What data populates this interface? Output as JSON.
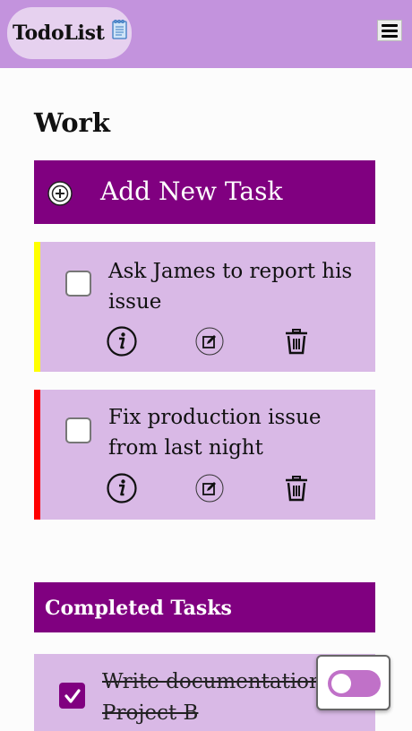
{
  "header": {
    "brand": "TodoList",
    "brand_icon": "notepad-icon",
    "menu_icon": "hamburger-menu-icon",
    "background": "#c393dd"
  },
  "main": {
    "section_title": "Work",
    "add_task_label": "Add New Task",
    "tasks": [
      {
        "text": "Ask James to report his issue",
        "checked": false,
        "priority_color": "#ffff00"
      },
      {
        "text": "Fix production issue from last night",
        "checked": false,
        "priority_color": "#ff0000"
      }
    ],
    "task_actions": [
      "info-icon",
      "edit-icon",
      "trash-icon"
    ],
    "completed_title": "Completed Tasks",
    "completed_tasks": [
      {
        "text": "Write documentation Project B",
        "checked": true
      }
    ],
    "theme_toggle": {
      "on": false
    }
  },
  "colors": {
    "accent": "#800080",
    "card": "#d9b9e6"
  }
}
